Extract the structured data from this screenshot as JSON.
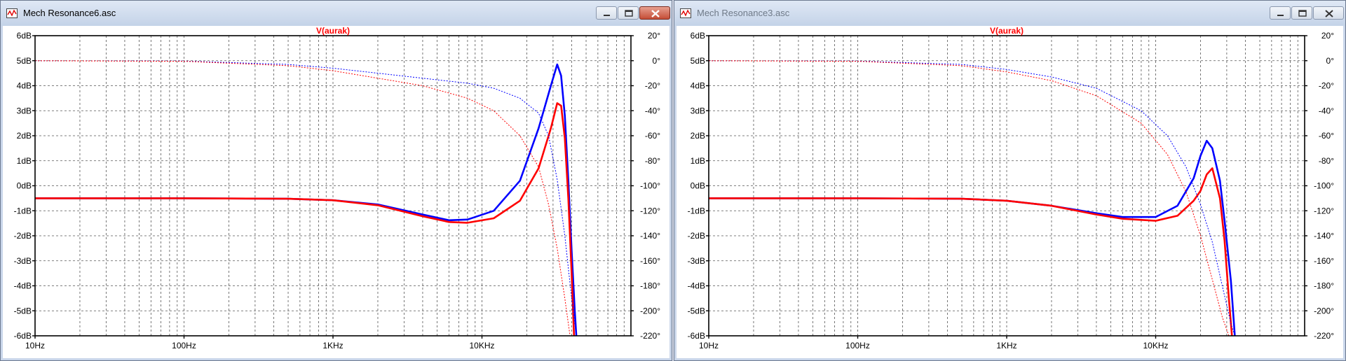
{
  "colors": {
    "accent": "#ff0000",
    "blue_series": "#0000ff",
    "red_series": "#ff0000",
    "grid": "#555555"
  },
  "windows": [
    {
      "title": "Mech Resonance6.asc",
      "active": true,
      "icons": [
        "waveform-icon",
        "minimize-icon",
        "maximize-icon",
        "close-icon"
      ]
    },
    {
      "title": "Mech Resonance3.asc",
      "active": false,
      "icons": [
        "waveform-icon",
        "minimize-icon",
        "maximize-icon",
        "close-icon"
      ]
    }
  ],
  "chart_data": [
    {
      "type": "line",
      "title": "V(aurak)",
      "x_axis": {
        "scale": "log",
        "range_hz": [
          10,
          100000
        ],
        "tick_labels": [
          "10Hz",
          "100Hz",
          "1KHz",
          "10KHz"
        ]
      },
      "y_left": {
        "range": [
          -6,
          6
        ],
        "unit": "dB",
        "tick_labels": [
          "6dB",
          "5dB",
          "4dB",
          "3dB",
          "2dB",
          "1dB",
          "0dB",
          "-1dB",
          "-2dB",
          "-3dB",
          "-4dB",
          "-5dB",
          "-6dB"
        ]
      },
      "y_right": {
        "range": [
          -220,
          20
        ],
        "unit": "deg",
        "tick_labels": [
          "20°",
          "0°",
          "-20°",
          "-40°",
          "-60°",
          "-80°",
          "-100°",
          "-120°",
          "-140°",
          "-160°",
          "-180°",
          "-200°",
          "-220°"
        ]
      },
      "grid": true,
      "series": [
        {
          "color": "blue",
          "style": "solid",
          "kind": "magnitude_dB",
          "points": [
            [
              10,
              -0.5
            ],
            [
              100,
              -0.5
            ],
            [
              500,
              -0.52
            ],
            [
              1000,
              -0.58
            ],
            [
              2000,
              -0.75
            ],
            [
              4000,
              -1.15
            ],
            [
              6000,
              -1.38
            ],
            [
              8000,
              -1.35
            ],
            [
              12000,
              -1.0
            ],
            [
              18000,
              0.2
            ],
            [
              24000,
              2.3
            ],
            [
              29000,
              4.0
            ],
            [
              32000,
              4.85
            ],
            [
              34000,
              4.4
            ],
            [
              36000,
              2.8
            ],
            [
              38000,
              0.2
            ],
            [
              40000,
              -2.6
            ],
            [
              42000,
              -5.0
            ],
            [
              43000,
              -6
            ]
          ]
        },
        {
          "color": "red",
          "style": "solid",
          "kind": "magnitude_dB",
          "points": [
            [
              10,
              -0.5
            ],
            [
              100,
              -0.5
            ],
            [
              500,
              -0.52
            ],
            [
              1000,
              -0.58
            ],
            [
              2000,
              -0.78
            ],
            [
              4000,
              -1.22
            ],
            [
              6000,
              -1.45
            ],
            [
              8000,
              -1.48
            ],
            [
              12000,
              -1.3
            ],
            [
              18000,
              -0.6
            ],
            [
              24000,
              0.7
            ],
            [
              29000,
              2.3
            ],
            [
              32000,
              3.3
            ],
            [
              34000,
              3.2
            ],
            [
              36000,
              1.9
            ],
            [
              38000,
              -0.5
            ],
            [
              40000,
              -3.5
            ],
            [
              41500,
              -6
            ]
          ]
        },
        {
          "color": "blue",
          "style": "dashed",
          "kind": "phase_deg",
          "points": [
            [
              10,
              0
            ],
            [
              100,
              -0.3
            ],
            [
              500,
              -3
            ],
            [
              1000,
              -6
            ],
            [
              2000,
              -10
            ],
            [
              4000,
              -14
            ],
            [
              8000,
              -18
            ],
            [
              12000,
              -22
            ],
            [
              18000,
              -30
            ],
            [
              24000,
              -42
            ],
            [
              28000,
              -60
            ],
            [
              32000,
              -95
            ],
            [
              36000,
              -140
            ],
            [
              40000,
              -190
            ],
            [
              43000,
              -220
            ]
          ]
        },
        {
          "color": "red",
          "style": "dashed",
          "kind": "phase_deg",
          "points": [
            [
              10,
              0
            ],
            [
              100,
              -0.5
            ],
            [
              500,
              -4
            ],
            [
              1000,
              -8
            ],
            [
              2000,
              -14
            ],
            [
              4000,
              -20
            ],
            [
              8000,
              -30
            ],
            [
              12000,
              -40
            ],
            [
              18000,
              -60
            ],
            [
              24000,
              -85
            ],
            [
              28000,
              -115
            ],
            [
              32000,
              -150
            ],
            [
              36000,
              -190
            ],
            [
              39000,
              -220
            ]
          ]
        }
      ]
    },
    {
      "type": "line",
      "title": "V(aurak)",
      "x_axis": {
        "scale": "log",
        "range_hz": [
          10,
          100000
        ],
        "tick_labels": [
          "10Hz",
          "100Hz",
          "1KHz",
          "10KHz"
        ]
      },
      "y_left": {
        "range": [
          -6,
          6
        ],
        "unit": "dB",
        "tick_labels": [
          "6dB",
          "5dB",
          "4dB",
          "3dB",
          "2dB",
          "1dB",
          "0dB",
          "-1dB",
          "-2dB",
          "-3dB",
          "-4dB",
          "-5dB",
          "-6dB"
        ]
      },
      "y_right": {
        "range": [
          -220,
          20
        ],
        "unit": "deg",
        "tick_labels": [
          "20°",
          "0°",
          "-20°",
          "-40°",
          "-60°",
          "-80°",
          "-100°",
          "-120°",
          "-140°",
          "-160°",
          "-180°",
          "-200°",
          "-220°"
        ]
      },
      "grid": true,
      "series": [
        {
          "color": "blue",
          "style": "solid",
          "kind": "magnitude_dB",
          "points": [
            [
              10,
              -0.5
            ],
            [
              100,
              -0.5
            ],
            [
              500,
              -0.52
            ],
            [
              1000,
              -0.6
            ],
            [
              2000,
              -0.8
            ],
            [
              4000,
              -1.1
            ],
            [
              6000,
              -1.25
            ],
            [
              10000,
              -1.25
            ],
            [
              14000,
              -0.8
            ],
            [
              18000,
              0.3
            ],
            [
              20000,
              1.2
            ],
            [
              22000,
              1.8
            ],
            [
              24000,
              1.5
            ],
            [
              27000,
              0.2
            ],
            [
              29000,
              -1.4
            ],
            [
              32000,
              -3.8
            ],
            [
              34000,
              -6
            ]
          ]
        },
        {
          "color": "red",
          "style": "solid",
          "kind": "magnitude_dB",
          "points": [
            [
              10,
              -0.5
            ],
            [
              100,
              -0.5
            ],
            [
              500,
              -0.52
            ],
            [
              1000,
              -0.6
            ],
            [
              2000,
              -0.8
            ],
            [
              4000,
              -1.15
            ],
            [
              6000,
              -1.32
            ],
            [
              10000,
              -1.4
            ],
            [
              14000,
              -1.2
            ],
            [
              18000,
              -0.6
            ],
            [
              20000,
              -0.2
            ],
            [
              22000,
              0.45
            ],
            [
              24000,
              0.7
            ],
            [
              27000,
              -0.5
            ],
            [
              29000,
              -2.2
            ],
            [
              31000,
              -4.5
            ],
            [
              32500,
              -6
            ]
          ]
        },
        {
          "color": "blue",
          "style": "dashed",
          "kind": "phase_deg",
          "points": [
            [
              10,
              0
            ],
            [
              100,
              -0.3
            ],
            [
              500,
              -3
            ],
            [
              1000,
              -7
            ],
            [
              2000,
              -13
            ],
            [
              4000,
              -22
            ],
            [
              8000,
              -40
            ],
            [
              12000,
              -60
            ],
            [
              16000,
              -85
            ],
            [
              20000,
              -115
            ],
            [
              24000,
              -145
            ],
            [
              28000,
              -180
            ],
            [
              32000,
              -210
            ],
            [
              34000,
              -220
            ]
          ]
        },
        {
          "color": "red",
          "style": "dashed",
          "kind": "phase_deg",
          "points": [
            [
              10,
              0
            ],
            [
              100,
              -0.5
            ],
            [
              500,
              -4
            ],
            [
              1000,
              -9
            ],
            [
              2000,
              -16
            ],
            [
              4000,
              -28
            ],
            [
              8000,
              -50
            ],
            [
              12000,
              -75
            ],
            [
              16000,
              -105
            ],
            [
              20000,
              -140
            ],
            [
              24000,
              -175
            ],
            [
              28000,
              -205
            ],
            [
              31000,
              -220
            ]
          ]
        }
      ]
    }
  ]
}
